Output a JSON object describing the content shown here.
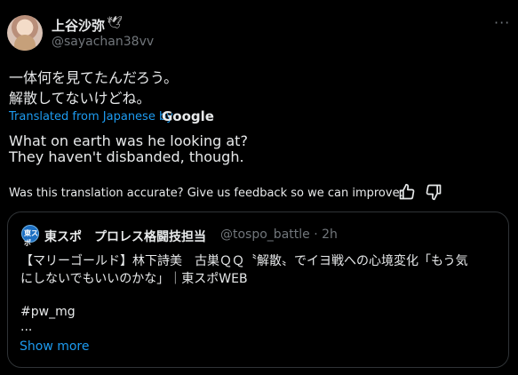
{
  "author": {
    "display_name": "上谷沙弥",
    "badge_icon": "dove-icon",
    "handle": "@sayachan38vv"
  },
  "tweet": {
    "original_lines": [
      "一体何を見てたんだろう。",
      "解散してないけどね。"
    ],
    "translated_label": "Translated from Japanese by",
    "translator": "Google",
    "translation_lines": [
      "What on earth was he looking at?",
      "They haven't disbanded, though."
    ],
    "feedback_prompt": "Was this translation accurate? Give us feedback so we can improve:"
  },
  "quoted": {
    "name": "東スポ　プロレス格闘技担当",
    "handle_time": "@tospo_battle · 2h",
    "avatar_label": "東スポ",
    "lines": [
      "【マリーゴールド】林下詩美　古巣ＱＱ〝解散〟でイヨ戦への心境変化「もう気",
      "にしないでもいいのかな」｜東スポWEB",
      "#pw_mg",
      "..."
    ],
    "show_more": "Show more"
  },
  "colors": {
    "background": "#000000",
    "text": "#e7e9ea",
    "muted": "#71767b",
    "link": "#1d9bf0",
    "border": "#2f3336"
  }
}
